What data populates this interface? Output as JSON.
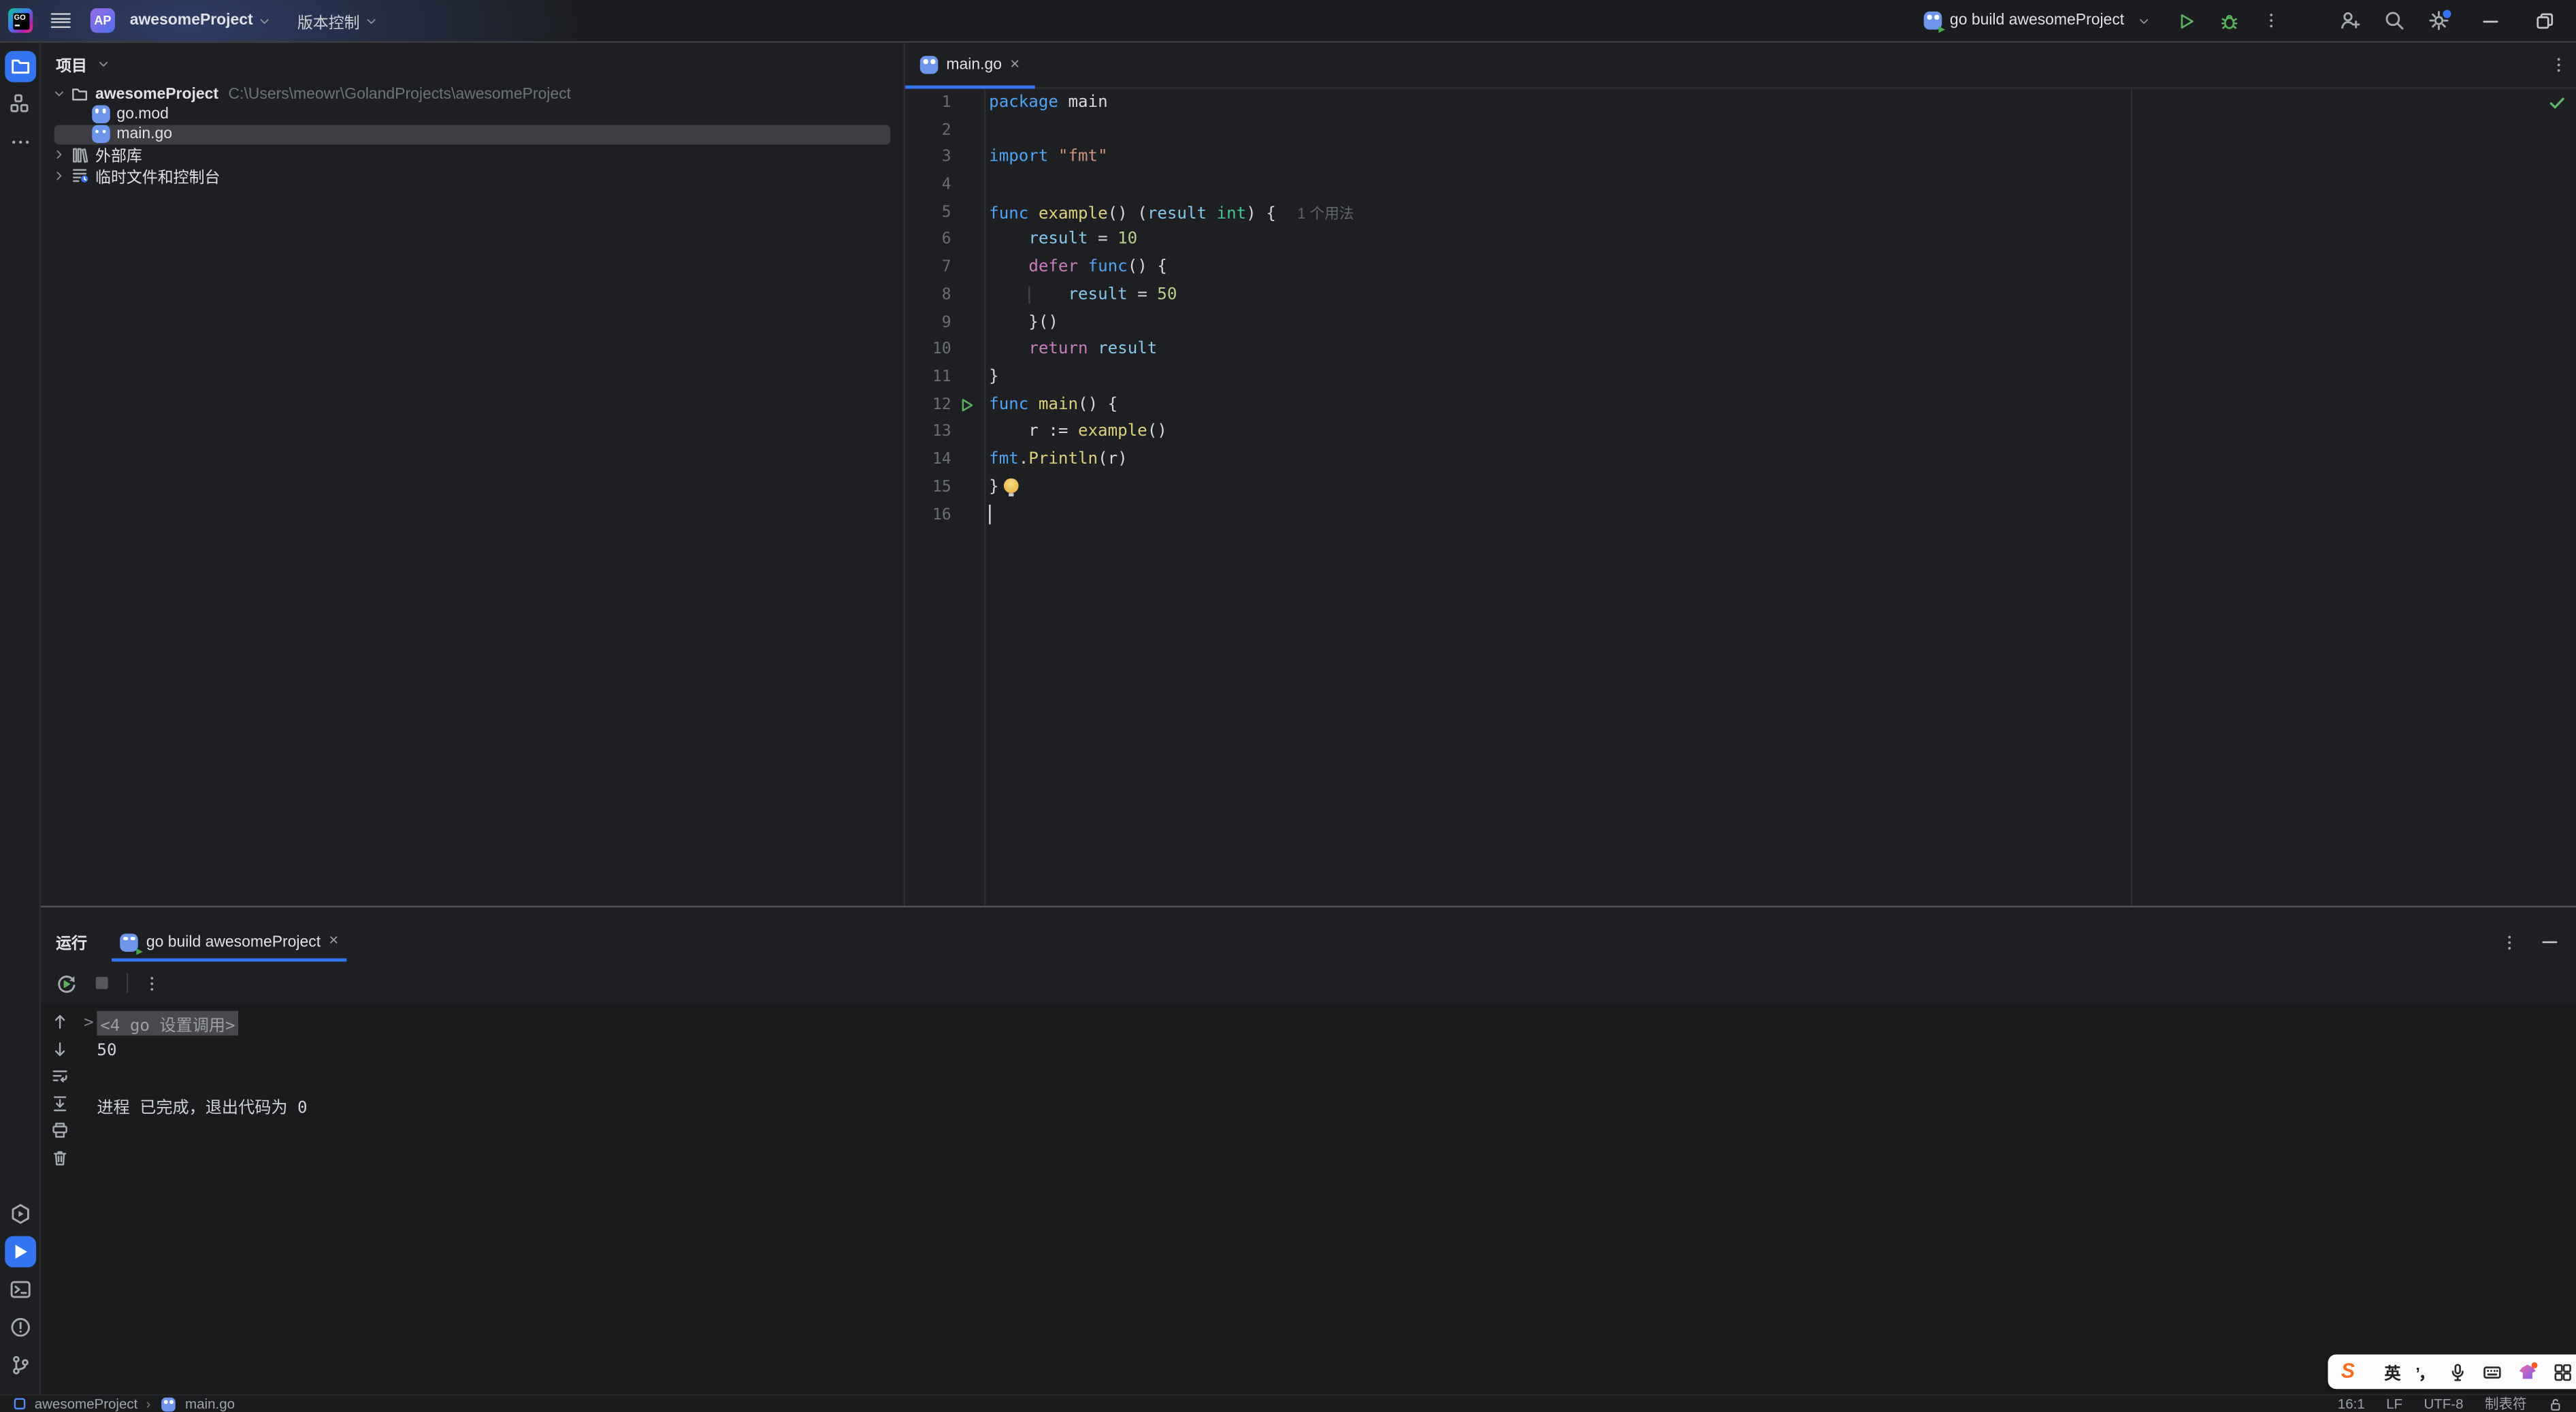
{
  "titlebar": {
    "app_icon": "goland-logo",
    "logo_text": "GO",
    "project_badge": "AP",
    "project_name": "awesomeProject",
    "vcs_label": "版本控制",
    "run_config_label": "go build awesomeProject"
  },
  "left_strip": {
    "top": [
      {
        "name": "project",
        "icon": "folder",
        "active": true
      },
      {
        "name": "structure",
        "icon": "structure",
        "active": false
      },
      {
        "name": "more-tool-windows",
        "icon": "more",
        "active": false
      }
    ],
    "bottom": [
      {
        "name": "services",
        "icon": "services",
        "active": false
      },
      {
        "name": "run",
        "icon": "play",
        "active": true
      },
      {
        "name": "terminal",
        "icon": "terminal",
        "active": false
      },
      {
        "name": "problems",
        "icon": "problems",
        "active": false
      },
      {
        "name": "version-control",
        "icon": "branch",
        "active": false
      }
    ]
  },
  "project_panel": {
    "title": "项目",
    "tree": [
      {
        "label": "awesomeProject",
        "path": "C:\\Users\\meowr\\GolandProjects\\awesomeProject",
        "icon": "folder-tree",
        "chevron": "down",
        "depth": 0,
        "bold": true,
        "selected": false
      },
      {
        "label": "go.mod",
        "icon": "gopher",
        "chevron": null,
        "depth": 1,
        "bold": false,
        "selected": false
      },
      {
        "label": "main.go",
        "icon": "gopher",
        "chevron": null,
        "depth": 1,
        "bold": false,
        "selected": true
      },
      {
        "label": "外部库",
        "icon": "library",
        "chevron": "right",
        "depth": 0,
        "bold": false,
        "selected": false
      },
      {
        "label": "临时文件和控制台",
        "icon": "scratches",
        "chevron": "right",
        "depth": 0,
        "bold": false,
        "selected": false
      }
    ]
  },
  "editor": {
    "tab_label": "main.go",
    "inspection_status": "no-problems",
    "inlay_hint": "1 个用法",
    "lines": [
      {
        "n": 1,
        "seg": [
          [
            "kw",
            "package"
          ],
          [
            "pl",
            " main"
          ]
        ]
      },
      {
        "n": 2,
        "seg": []
      },
      {
        "n": 3,
        "seg": [
          [
            "kw",
            "import"
          ],
          [
            "pl",
            " "
          ],
          [
            "st",
            "\"fmt\""
          ]
        ]
      },
      {
        "n": 4,
        "seg": []
      },
      {
        "n": 5,
        "seg": [
          [
            "kw",
            "func"
          ],
          [
            "pl",
            " "
          ],
          [
            "fn",
            "example"
          ],
          [
            "pl",
            "() ("
          ],
          [
            "vr",
            "result"
          ],
          [
            "pl",
            " "
          ],
          [
            "ty",
            "int"
          ],
          [
            "pl",
            ") { "
          ],
          [
            "in",
            "1 个用法"
          ]
        ]
      },
      {
        "n": 6,
        "seg": [
          [
            "pl",
            "    "
          ],
          [
            "vr",
            "result"
          ],
          [
            "pl",
            " = "
          ],
          [
            "nu",
            "10"
          ]
        ]
      },
      {
        "n": 7,
        "seg": [
          [
            "pl",
            "    "
          ],
          [
            "ct",
            "defer"
          ],
          [
            "pl",
            " "
          ],
          [
            "kw",
            "func"
          ],
          [
            "pl",
            "() {"
          ]
        ]
      },
      {
        "n": 8,
        "seg": [
          [
            "pl",
            "    "
          ],
          [
            "gd",
            "    "
          ],
          [
            "vr",
            "result"
          ],
          [
            "pl",
            " = "
          ],
          [
            "nu",
            "50"
          ]
        ]
      },
      {
        "n": 9,
        "seg": [
          [
            "pl",
            "    }()"
          ]
        ]
      },
      {
        "n": 10,
        "seg": [
          [
            "pl",
            "    "
          ],
          [
            "ct",
            "return"
          ],
          [
            "pl",
            " "
          ],
          [
            "vr",
            "result"
          ]
        ]
      },
      {
        "n": 11,
        "seg": [
          [
            "pl",
            "}"
          ]
        ]
      },
      {
        "n": 12,
        "run": true,
        "seg": [
          [
            "kw",
            "func"
          ],
          [
            "pl",
            " "
          ],
          [
            "fn",
            "main"
          ],
          [
            "pl",
            "() {"
          ]
        ]
      },
      {
        "n": 13,
        "seg": [
          [
            "pl",
            "    r := "
          ],
          [
            "fn",
            "example"
          ],
          [
            "pl",
            "()"
          ]
        ]
      },
      {
        "n": 14,
        "seg": [
          [
            "kw",
            "fmt"
          ],
          [
            "pl",
            "."
          ],
          [
            "fn",
            "Println"
          ],
          [
            "pl",
            "(r)"
          ]
        ]
      },
      {
        "n": 15,
        "seg": [
          [
            "pl",
            "}"
          ],
          [
            "bulb",
            ""
          ]
        ]
      },
      {
        "n": 16,
        "caret": true,
        "seg": []
      }
    ]
  },
  "run_panel": {
    "title": "运行",
    "tab_label": "go build awesomeProject",
    "gutter_icons": [
      "arrow-up",
      "arrow-down",
      "soft-wrap",
      "scroll-to-end",
      "print",
      "clear"
    ],
    "console": [
      {
        "kind": "command-folded",
        "fold": ">",
        "text": "<4 go 设置调用>"
      },
      {
        "kind": "output",
        "text": "50"
      },
      {
        "kind": "output",
        "text": ""
      },
      {
        "kind": "output",
        "text": "进程 已完成，退出代码为 0"
      }
    ]
  },
  "statusbar": {
    "project": "awesomeProject",
    "separator": "›",
    "file": "main.go",
    "caret_position": "16:1",
    "line_separator": "LF",
    "encoding": "UTF-8",
    "indent": "制表符"
  },
  "ime_bar": {
    "brand": "S",
    "lang": "英",
    "punct": "’，"
  },
  "colors": {
    "accent": "#3574F0",
    "run_green": "#5CB15C",
    "editor_bg": "#1E1F22",
    "console_bg": "#1A1B1D"
  }
}
